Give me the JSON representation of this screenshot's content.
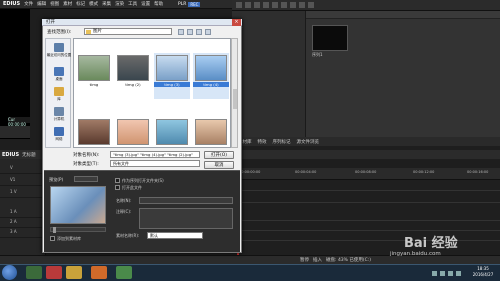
{
  "menubar": {
    "logo": "EDIUS",
    "items": [
      "文件",
      "编辑",
      "视图",
      "素材",
      "标记",
      "模式",
      "采集",
      "渲染",
      "工具",
      "设置",
      "帮助"
    ],
    "plr": "PLR",
    "rec": "REC"
  },
  "left_player": {
    "timecode": "Cur 00:00:00"
  },
  "bin": {
    "tree_item": "根",
    "clip_label": "序列1",
    "tabs": [
      "素材库",
      "特效",
      "序列标记",
      "源文件浏览"
    ]
  },
  "timeline": {
    "logo": "EDIUS",
    "project": "无标题",
    "tracks": [
      "",
      "V",
      "V1",
      "1 V",
      "1 A",
      "2 A",
      "3 A"
    ],
    "ruler": [
      "00:00:00:00",
      "00:00:04:00",
      "00:00:08:00",
      "00:00:12:00",
      "00:00:16:00"
    ],
    "status": [
      "暂停",
      "插入",
      "磁盘: 43% 已使用(C:)"
    ]
  },
  "dialog": {
    "title": "打开",
    "close": "×",
    "look_in_label": "查找范围(I):",
    "look_in_value": "图片",
    "places": [
      {
        "label": "最近访问的位置",
        "color": "#5c7ea8"
      },
      {
        "label": "桌面",
        "color": "#4a76b6"
      },
      {
        "label": "库",
        "color": "#d9a940"
      },
      {
        "label": "计算机",
        "color": "#6a86a8"
      },
      {
        "label": "网络",
        "color": "#3f6db3"
      }
    ],
    "files": [
      {
        "name": "timg",
        "color": "#7c9a6c",
        "selected": false
      },
      {
        "name": "timg (2)",
        "color": "#4e5a62",
        "selected": false
      },
      {
        "name": "timg (3)",
        "color": "#8fb2d6",
        "selected": true
      },
      {
        "name": "timg (4)",
        "color": "#6ea0d6",
        "selected": true
      },
      {
        "name": "",
        "color": "#7a5a4a",
        "selected": false
      },
      {
        "name": "",
        "color": "#e0a890",
        "selected": false
      },
      {
        "name": "",
        "color": "#63a0c4",
        "selected": false
      },
      {
        "name": "",
        "color": "#caa488",
        "selected": false
      }
    ],
    "filename_label": "对象名称(N):",
    "filename_value": "\"timg (3).jpg\" \"timg (4).jpg\" \"timg (2).jpg\"",
    "filetype_label": "对象类型(T):",
    "filetype_value": "所有文件",
    "open_button": "打开(O)",
    "cancel_button": "取消",
    "preview_label": "预览(P)",
    "preview_option": "",
    "checkbox_sequence": "作为序列打开文件夹(S)",
    "checkbox_file": "打开此文件",
    "name_label": "名称(N):",
    "notes_label": "注释(C):",
    "reel_label": "素材名称(R):",
    "reel_value": "默认",
    "add_check_label": "添加到素材库"
  },
  "watermark": {
    "big": "Bai 经验",
    "small": "jingyan.baidu.com"
  },
  "taskbar": {
    "time": "18:35",
    "date": "2016/4/27"
  }
}
